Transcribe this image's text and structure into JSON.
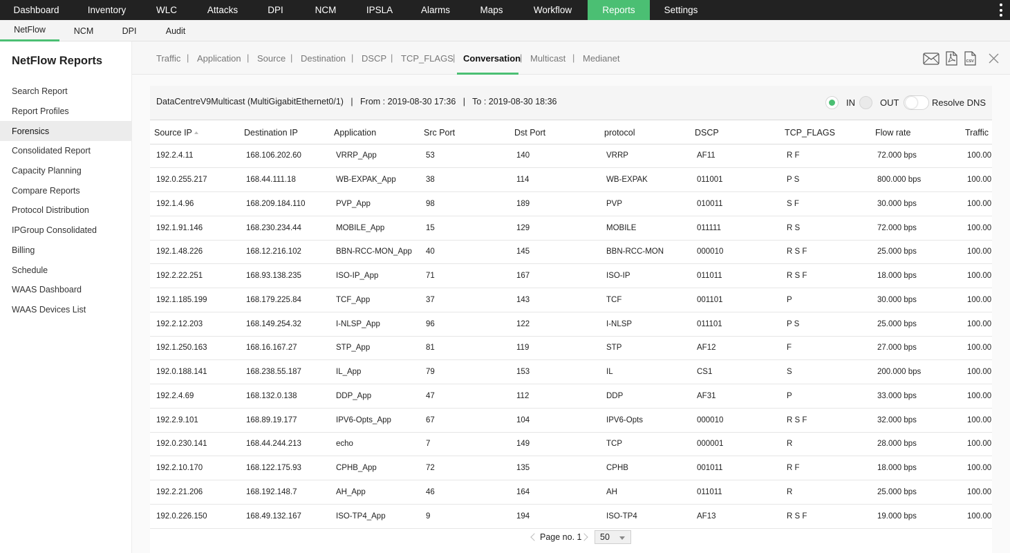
{
  "topnav": {
    "items": [
      {
        "label": "Dashboard"
      },
      {
        "label": "Inventory"
      },
      {
        "label": "WLC"
      },
      {
        "label": "Attacks"
      },
      {
        "label": "DPI"
      },
      {
        "label": "NCM"
      },
      {
        "label": "IPSLA"
      },
      {
        "label": "Alarms"
      },
      {
        "label": "Maps"
      },
      {
        "label": "Workflow"
      },
      {
        "label": "Reports"
      },
      {
        "label": "Settings"
      }
    ],
    "active": "Reports",
    "accent": "#4bbf73",
    "background": "#222222"
  },
  "subnav": {
    "items": [
      {
        "label": "NetFlow"
      },
      {
        "label": "NCM"
      },
      {
        "label": "DPI"
      },
      {
        "label": "Audit"
      }
    ],
    "active": "NetFlow"
  },
  "sidebar": {
    "title": "NetFlow Reports",
    "items": [
      {
        "label": "Search Report"
      },
      {
        "label": "Report Profiles"
      },
      {
        "label": "Forensics"
      },
      {
        "label": "Consolidated Report"
      },
      {
        "label": "Capacity Planning"
      },
      {
        "label": "Compare Reports"
      },
      {
        "label": "Protocol Distribution"
      },
      {
        "label": "IPGroup Consolidated"
      },
      {
        "label": "Billing"
      },
      {
        "label": "Schedule"
      },
      {
        "label": "WAAS Dashboard"
      },
      {
        "label": "WAAS Devices List"
      }
    ],
    "active": "Forensics"
  },
  "tabs": {
    "items": [
      {
        "label": "Traffic"
      },
      {
        "label": "Application"
      },
      {
        "label": "Source"
      },
      {
        "label": "Destination"
      },
      {
        "label": "DSCP"
      },
      {
        "label": "TCP_FLAGS"
      },
      {
        "label": "Conversation"
      },
      {
        "label": "Multicast"
      },
      {
        "label": "Medianet"
      }
    ],
    "separator": "|",
    "active": "Conversation"
  },
  "toolbar": {
    "icons": [
      "email-icon",
      "pdf-icon",
      "csv-icon",
      "close-icon"
    ],
    "csv_text": "CSV"
  },
  "infobar": {
    "text": "DataCentreV9Multicast (MultiGigabitEthernet0/1)   |   From : 2019-08-30 17:36   |   To : 2019-08-30 18:36",
    "in_label": "IN",
    "out_label": "OUT",
    "in_selected": true,
    "resolve_dns_label": "Resolve DNS",
    "resolve_dns_on": false
  },
  "table": {
    "columns": [
      "Source IP",
      "Destination IP",
      "Application",
      "Src Port",
      "Dst Port",
      "protocol",
      "DSCP",
      "TCP_FLAGS",
      "Flow rate",
      "Traffic"
    ],
    "sorted_column": "Source IP",
    "rows": [
      [
        "192.2.4.11",
        "168.106.202.60",
        "VRRP_App",
        "53",
        "140",
        "VRRP",
        "AF11",
        "R F",
        "72.000 bps",
        "100.00"
      ],
      [
        "192.0.255.217",
        "168.44.111.18",
        "WB-EXPAK_App",
        "38",
        "114",
        "WB-EXPAK",
        "011001",
        "P S",
        "800.000 bps",
        "100.00"
      ],
      [
        "192.1.4.96",
        "168.209.184.110",
        "PVP_App",
        "98",
        "189",
        "PVP",
        "010011",
        "S F",
        "30.000 bps",
        "100.00"
      ],
      [
        "192.1.91.146",
        "168.230.234.44",
        "MOBILE_App",
        "15",
        "129",
        "MOBILE",
        "011111",
        "R S",
        "72.000 bps",
        "100.00"
      ],
      [
        "192.1.48.226",
        "168.12.216.102",
        "BBN-RCC-MON_App",
        "40",
        "145",
        "BBN-RCC-MON",
        "000010",
        "R S F",
        "25.000 bps",
        "100.00"
      ],
      [
        "192.2.22.251",
        "168.93.138.235",
        "ISO-IP_App",
        "71",
        "167",
        "ISO-IP",
        "011011",
        "R S F",
        "18.000 bps",
        "100.00"
      ],
      [
        "192.1.185.199",
        "168.179.225.84",
        "TCF_App",
        "37",
        "143",
        "TCF",
        "001101",
        "P",
        "30.000 bps",
        "100.00"
      ],
      [
        "192.2.12.203",
        "168.149.254.32",
        "I-NLSP_App",
        "96",
        "122",
        "I-NLSP",
        "011101",
        "P S",
        "25.000 bps",
        "100.00"
      ],
      [
        "192.1.250.163",
        "168.16.167.27",
        "STP_App",
        "81",
        "119",
        "STP",
        "AF12",
        "F",
        "27.000 bps",
        "100.00"
      ],
      [
        "192.0.188.141",
        "168.238.55.187",
        "IL_App",
        "79",
        "153",
        "IL",
        "CS1",
        "S",
        "200.000 bps",
        "100.00"
      ],
      [
        "192.2.4.69",
        "168.132.0.138",
        "DDP_App",
        "47",
        "112",
        "DDP",
        "AF31",
        "P",
        "33.000 bps",
        "100.00"
      ],
      [
        "192.2.9.101",
        "168.89.19.177",
        "IPV6-Opts_App",
        "67",
        "104",
        "IPV6-Opts",
        "000010",
        "R S F",
        "32.000 bps",
        "100.00"
      ],
      [
        "192.0.230.141",
        "168.44.244.213",
        "echo",
        "7",
        "149",
        "TCP",
        "000001",
        "R",
        "28.000 bps",
        "100.00"
      ],
      [
        "192.2.10.170",
        "168.122.175.93",
        "CPHB_App",
        "72",
        "135",
        "CPHB",
        "001011",
        "R F",
        "18.000 bps",
        "100.00"
      ],
      [
        "192.2.21.206",
        "168.192.148.7",
        "AH_App",
        "46",
        "164",
        "AH",
        "011011",
        "R",
        "25.000 bps",
        "100.00"
      ],
      [
        "192.0.226.150",
        "168.49.132.167",
        "ISO-TP4_App",
        "9",
        "194",
        "ISO-TP4",
        "AF13",
        "R S F",
        "19.000 bps",
        "100.00"
      ]
    ]
  },
  "pager": {
    "page_label": "Page no. 1",
    "page_size": "50"
  }
}
